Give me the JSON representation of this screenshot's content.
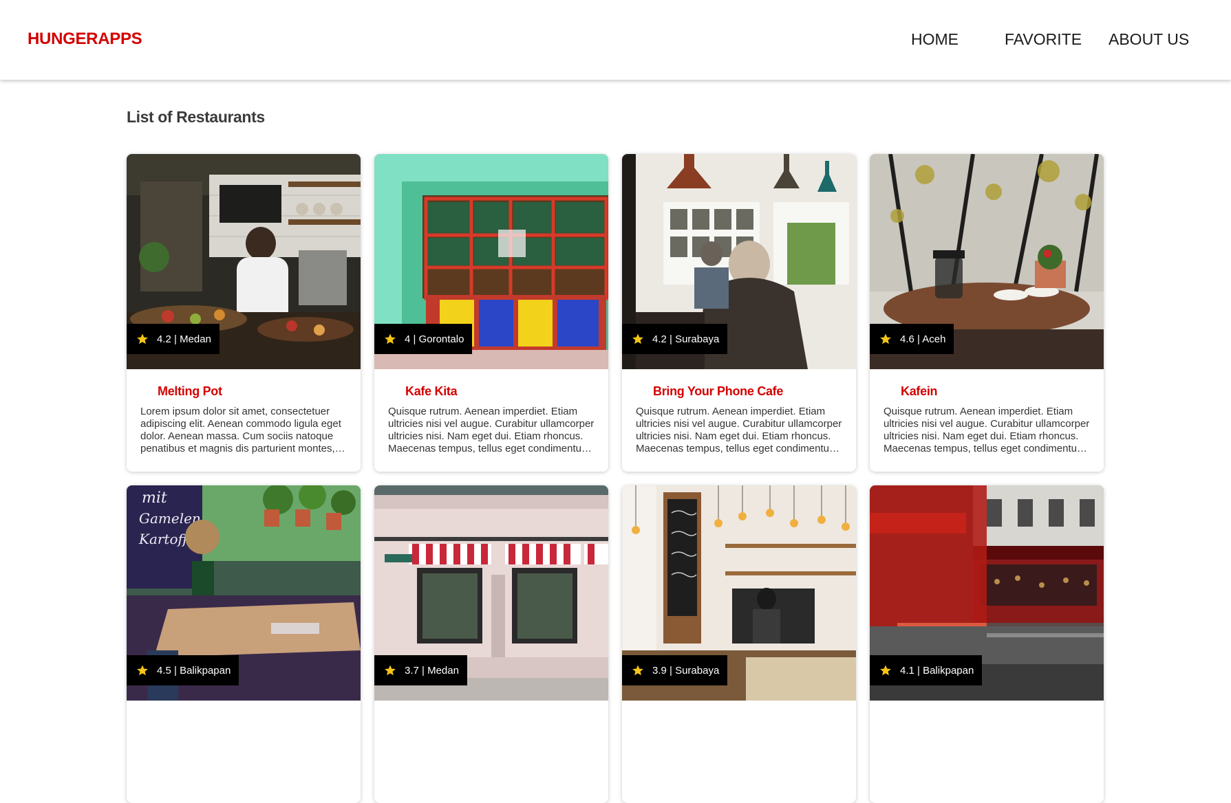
{
  "header": {
    "brand": "HUNGERAPPS",
    "nav": {
      "home": "HOME",
      "favorite": "FAVORITE",
      "about": "ABOUT US"
    }
  },
  "main": {
    "title": "List of Restaurants",
    "restaurants": [
      {
        "name": "Melting Pot",
        "rating_city": "4.2 | Medan",
        "description": "Lorem ipsum dolor sit amet, consectetuer adipiscing elit. Aenean commodo ligula eget dolor. Aenean massa. Cum sociis natoque penatibus et magnis dis parturient montes, nascetur ridiculus mus.",
        "image_icon": "kitchen-photo"
      },
      {
        "name": "Kafe Kita",
        "rating_city": "4 | Gorontalo",
        "description": "Quisque rutrum. Aenean imperdiet. Etiam ultricies nisi vel augue. Curabitur ullamcorper ultricies nisi. Nam eget dui. Etiam rhoncus. Maecenas tempus, tellus eget condimentum rhoncus.",
        "image_icon": "storefront-photo"
      },
      {
        "name": "Bring Your Phone Cafe",
        "rating_city": "4.2 | Surabaya",
        "description": "Quisque rutrum. Aenean imperdiet. Etiam ultricies nisi vel augue. Curabitur ullamcorper ultricies nisi. Nam eget dui. Etiam rhoncus. Maecenas tempus, tellus eget condimentum rhoncus.",
        "image_icon": "cafe-interior-photo"
      },
      {
        "name": "Kafein",
        "rating_city": "4.6 | Aceh",
        "description": "Quisque rutrum. Aenean imperdiet. Etiam ultricies nisi vel augue. Curabitur ullamcorper ultricies nisi. Nam eget dui. Etiam rhoncus. Maecenas tempus, tellus eget condimentum rhoncus.",
        "image_icon": "table-window-photo"
      },
      {
        "name": "",
        "rating_city": "4.5 | Balikpapan",
        "description": "",
        "image_icon": "chalkboard-photo"
      },
      {
        "name": "",
        "rating_city": "3.7 | Medan",
        "description": "",
        "image_icon": "awning-storefront-photo"
      },
      {
        "name": "",
        "rating_city": "3.9 | Surabaya",
        "description": "",
        "image_icon": "coffee-bar-photo"
      },
      {
        "name": "",
        "rating_city": "4.1 | Balikpapan",
        "description": "",
        "image_icon": "london-street-photo"
      }
    ]
  },
  "colors": {
    "brand": "#d40000",
    "badge_bg": "#000000",
    "star": "#f5c518"
  }
}
